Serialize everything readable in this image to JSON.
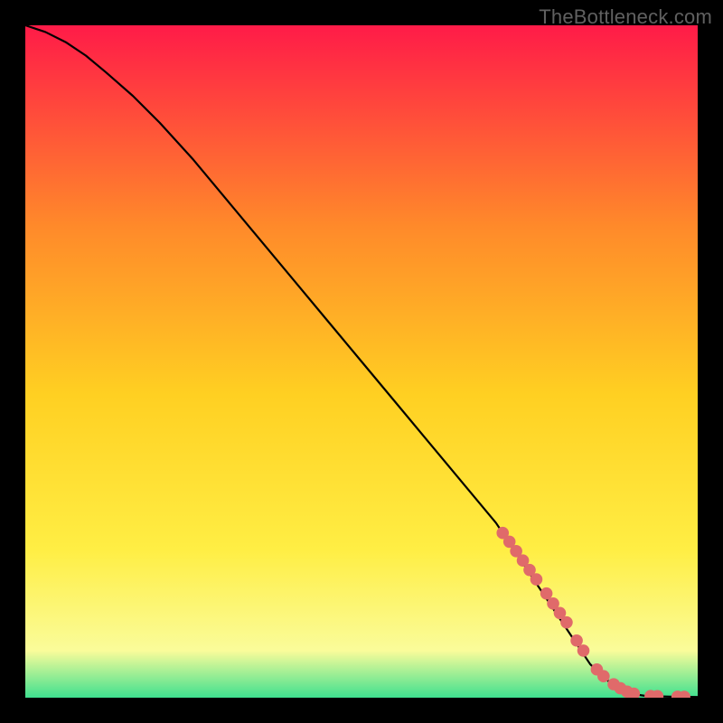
{
  "watermark": "TheBottleneck.com",
  "colors": {
    "gradient_top": "#ff1b48",
    "gradient_mid1": "#ff8a2a",
    "gradient_mid2": "#ffd022",
    "gradient_mid3": "#ffee44",
    "gradient_mid4": "#fafc9a",
    "gradient_bottom": "#3fe08f",
    "line": "#000000",
    "marker": "#e06a6a",
    "background": "#000000"
  },
  "chart_data": {
    "type": "line",
    "title": "",
    "xlabel": "",
    "ylabel": "",
    "xlim": [
      0,
      100
    ],
    "ylim": [
      0,
      100
    ],
    "grid": false,
    "legend": false,
    "series": [
      {
        "name": "curve",
        "x": [
          0,
          3,
          6,
          9,
          12,
          16,
          20,
          25,
          30,
          35,
          40,
          45,
          50,
          55,
          60,
          65,
          70,
          74,
          78,
          82,
          84,
          86,
          88,
          90,
          92,
          94,
          96,
          98,
          100
        ],
        "y": [
          100,
          99,
          97.5,
          95.5,
          93,
          89.5,
          85.5,
          80,
          74,
          68,
          62,
          56,
          50,
          44,
          38,
          32,
          26,
          20,
          14,
          8,
          5,
          3,
          1.5,
          0.6,
          0.3,
          0.2,
          0.15,
          0.12,
          0.1
        ]
      }
    ],
    "markers": {
      "name": "highlighted-points",
      "x": [
        71,
        72,
        73,
        74,
        75,
        76,
        77.5,
        78.5,
        79.5,
        80.5,
        82,
        83,
        85,
        86,
        87.5,
        88.5,
        89.5,
        90.5,
        93,
        94,
        97,
        98
      ],
      "y": [
        24.5,
        23.2,
        21.8,
        20.4,
        19,
        17.6,
        15.5,
        14,
        12.6,
        11.2,
        8.5,
        7,
        4.2,
        3.2,
        2,
        1.4,
        0.9,
        0.6,
        0.25,
        0.22,
        0.15,
        0.13
      ]
    }
  }
}
